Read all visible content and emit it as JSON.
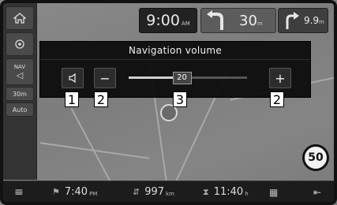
{
  "header": {
    "clock": "9:00",
    "clock_suffix": "AM",
    "next_turn_distance": "30",
    "next_turn_unit": "m",
    "second_turn_distance": "9.9",
    "second_turn_unit": "m"
  },
  "left_rail": {
    "items": [
      {
        "icon": "home-icon"
      },
      {
        "icon": "location-icon"
      },
      {
        "icon": "speaker-icon",
        "label": "NAV"
      },
      {
        "label": "30m"
      },
      {
        "label": "Auto"
      }
    ]
  },
  "volume_popup": {
    "title": "Navigation volume",
    "mute_icon": "speaker-icon",
    "minus_label": "−",
    "plus_label": "+",
    "value": "20",
    "level_fraction": 0.45
  },
  "callouts": [
    "1",
    "2",
    "3",
    "2"
  ],
  "map": {
    "speed_limit": "50"
  },
  "bottom_bar": {
    "eta_time": "7:40",
    "eta_suffix": "PM",
    "distance": "997",
    "distance_unit": "km",
    "remaining_time": "11:40",
    "remaining_unit": "h"
  },
  "colors": {
    "popup_bg": "#0a0a0a",
    "map_gray": "#808080",
    "accent": "#ffffff"
  }
}
